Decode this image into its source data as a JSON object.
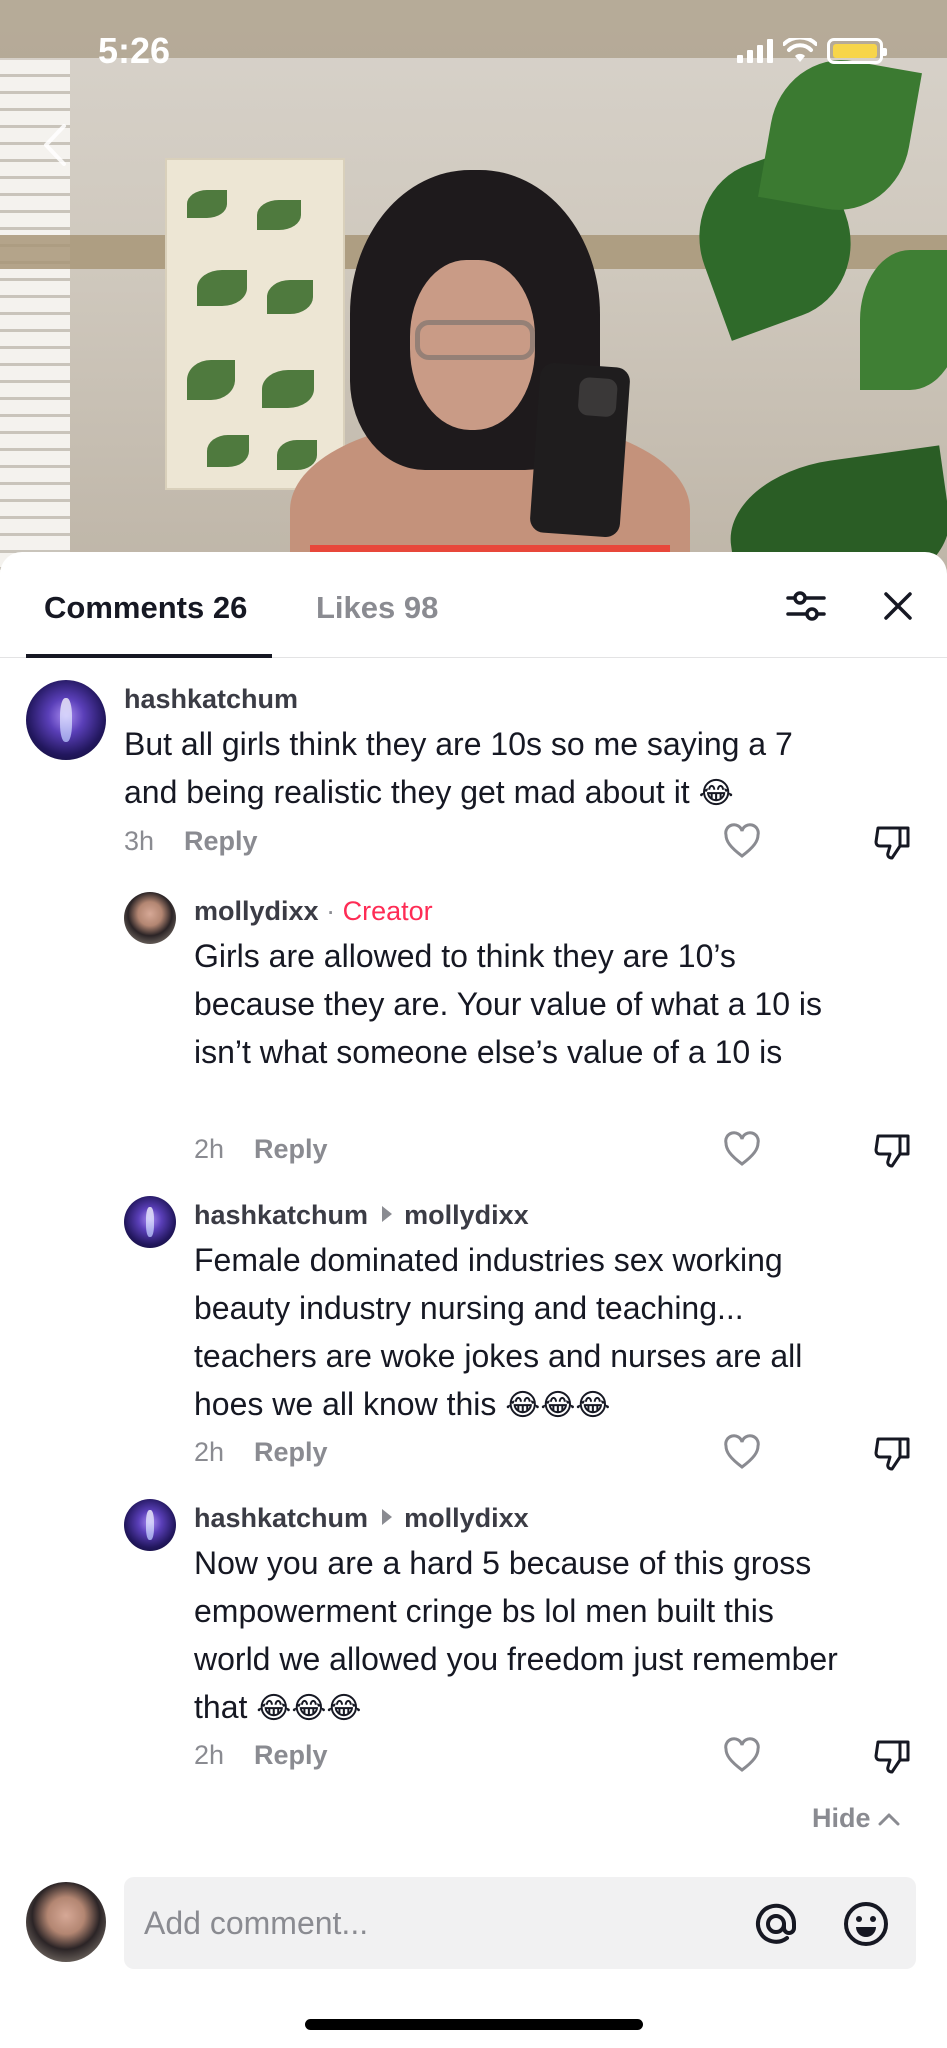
{
  "status_bar": {
    "time": "5:26"
  },
  "tabs": [
    {
      "label": "Comments",
      "count": "26"
    },
    {
      "label": "Likes",
      "count": "98"
    }
  ],
  "comments": [
    {
      "username": "hashkatchum",
      "text": "But all girls think they are 10s so me saying a 7 and being realistic they get mad about it",
      "emoji": "😂",
      "time": "3h",
      "reply_label": "Reply"
    }
  ],
  "replies": [
    {
      "username": "mollydixx",
      "badge_separator": "·",
      "badge": "Creator",
      "text": "Girls are allowed to think they are 10’s because they are. Your value of what a 10 is isn’t what someone else’s value of a 10 is",
      "time": "2h",
      "reply_label": "Reply"
    },
    {
      "username": "hashkatchum",
      "reply_to": "mollydixx",
      "text": "Female dominated industries sex working beauty industry nursing and teaching... teachers are woke jokes and nurses are all hoes we all know this",
      "emoji": "😂😂😂",
      "time": "2h",
      "reply_label": "Reply"
    },
    {
      "username": "hashkatchum",
      "reply_to": "mollydixx",
      "text": "Now you are a hard 5 because of this gross empowerment cringe bs lol men built this world we allowed you freedom just remember that",
      "emoji": "😂😂😂",
      "time": "2h",
      "reply_label": "Reply"
    }
  ],
  "hide_label": "Hide",
  "composer": {
    "placeholder": "Add comment..."
  },
  "colors": {
    "creator": "#fe2c55",
    "battery": "#f7d54a",
    "text_primary": "#161823",
    "text_secondary": "#8a8b91"
  },
  "icons": [
    "back-icon",
    "signal-icon",
    "wifi-icon",
    "battery-icon",
    "filter-icon",
    "close-icon",
    "heart-icon",
    "dislike-icon",
    "chevron-up-icon",
    "at-icon",
    "emoji-icon"
  ]
}
